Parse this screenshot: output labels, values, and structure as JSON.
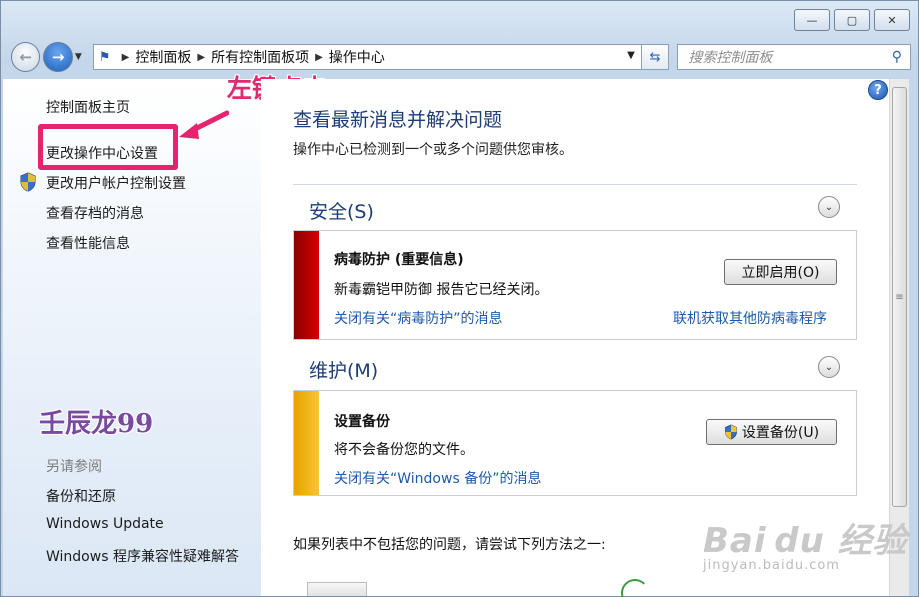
{
  "window": {
    "min_glyph": "—",
    "max_glyph": "▢",
    "close_glyph": "✕"
  },
  "nav": {
    "back_glyph": "←",
    "forward_glyph": "→",
    "breadcrumb": [
      "控制面板",
      "所有控制面板项",
      "操作中心"
    ],
    "search_placeholder": "搜索控制面板"
  },
  "left": {
    "items": [
      "控制面板主页",
      "更改操作中心设置",
      "更改用户帐户控制设置",
      "查看存档的消息",
      "查看性能信息"
    ],
    "see_also_label": "另请参阅",
    "see_also_items": [
      "备份和还原",
      "Windows Update",
      "Windows 程序兼容性疑难解答"
    ]
  },
  "annotations": {
    "click_hint": "左键点击",
    "author": "壬辰龙99"
  },
  "main": {
    "heading": "查看最新消息并解决问题",
    "subheading": "操作中心已检测到一个或多个问题供您审核。",
    "security": {
      "title": "安全(S)",
      "item_title": "病毒防护 (重要信息)",
      "item_desc": "新毒霸铠甲防御 报告它已经关闭。",
      "button": "立即启用(O)",
      "link_close": "关闭有关“病毒防护”的消息",
      "link_online": "联机获取其他防病毒程序",
      "bar_color": "#c80000"
    },
    "maintenance": {
      "title": "维护(M)",
      "item_title": "设置备份",
      "item_desc": "将不会备份您的文件。",
      "button": "设置备份(U)",
      "link_close": "关闭有关“Windows 备份”的消息",
      "bar_color": "#f0b400"
    },
    "footer": "如果列表中不包括您的问题，请尝试下列方法之一:"
  },
  "watermark": {
    "brand": "Bai du 经验",
    "url": "jingyan.baidu.com"
  }
}
